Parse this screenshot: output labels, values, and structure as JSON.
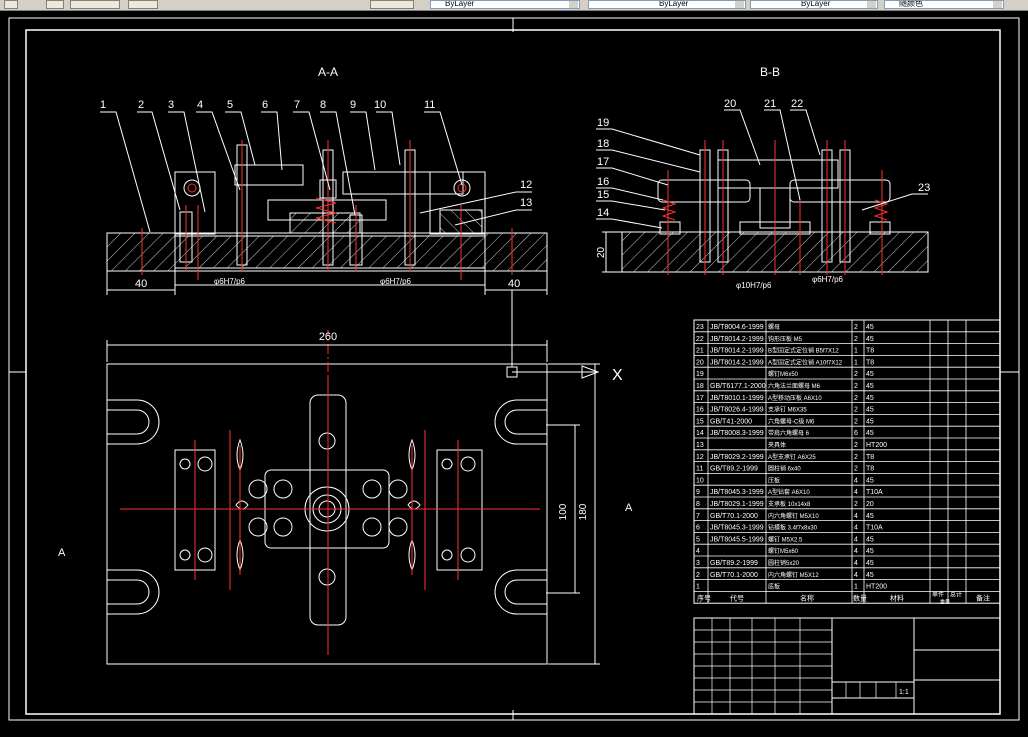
{
  "toolbar": {
    "layer_combo": "ByLayer",
    "linetype_combo": "ByLayer",
    "lineweight_combo": "ByLayer",
    "plotstyle_combo": "随颜色"
  },
  "drawing": {
    "section_aa": "A-A",
    "section_bb": "B-B",
    "view_marker_left": "A",
    "view_marker_right": "A",
    "ucs_x_label": "X",
    "dim_40_left": "40",
    "dim_40_right": "40",
    "dim_fit_a": "φ6H7/p6",
    "dim_fit_b": "φ6H7/p6",
    "dim_fit_c": "φ10H7/p6",
    "dim_fit_d": "φ6H7/p6",
    "dim_20": "20",
    "dim_260": "260",
    "dim_100": "100",
    "dim_180": "180",
    "balloons_aa": [
      "1",
      "2",
      "3",
      "4",
      "5",
      "6",
      "7",
      "8",
      "9",
      "10",
      "11",
      "12",
      "13"
    ],
    "balloons_bb": [
      "19",
      "18",
      "17",
      "16",
      "15",
      "14",
      "20",
      "21",
      "22",
      "23"
    ]
  },
  "bom": {
    "rows": [
      {
        "no": "23",
        "code": "JB/T8004.6-1999",
        "name": "螺母",
        "qty": "2",
        "mat": "45"
      },
      {
        "no": "22",
        "code": "JB/T8014.2-1999",
        "name": "钩形压板 M5",
        "qty": "2",
        "mat": "45"
      },
      {
        "no": "21",
        "code": "JB/T8014.2-1999",
        "name": "B型固定式定位销 B5f7X12",
        "qty": "1",
        "mat": "T8"
      },
      {
        "no": "20",
        "code": "JB/T8014.2-1999",
        "name": "A型固定式定位销 A10f7X12",
        "qty": "1",
        "mat": "T8"
      },
      {
        "no": "19",
        "code": "",
        "name": "螺钉M6x50",
        "qty": "2",
        "mat": "45"
      },
      {
        "no": "18",
        "code": "GB/T6177.1-2000",
        "name": "六角法兰面螺母 M6",
        "qty": "2",
        "mat": "45"
      },
      {
        "no": "17",
        "code": "JB/T8010.1-1999",
        "name": "A型移动压板 A6X10",
        "qty": "2",
        "mat": "45"
      },
      {
        "no": "16",
        "code": "JB/T8026.4-1999",
        "name": "支承钉 M6X35",
        "qty": "2",
        "mat": "45"
      },
      {
        "no": "15",
        "code": "GB/T41-2000",
        "name": "六角螺母-C级 M6",
        "qty": "2",
        "mat": "45"
      },
      {
        "no": "14",
        "code": "JB/T8008.3-1999",
        "name": "带肩六角螺母 6",
        "qty": "6",
        "mat": "45"
      },
      {
        "no": "13",
        "code": "",
        "name": "夹具体",
        "qty": "2",
        "mat": "HT200"
      },
      {
        "no": "12",
        "code": "JB/T8029.2-1999",
        "name": "A型支承钉 A6X25",
        "qty": "2",
        "mat": "T8"
      },
      {
        "no": "11",
        "code": "GB/T89.2-1999",
        "name": "圆柱销 6x40",
        "qty": "2",
        "mat": "T8"
      },
      {
        "no": "10",
        "code": "",
        "name": "压板",
        "qty": "4",
        "mat": "45"
      },
      {
        "no": "9",
        "code": "JB/T8045.3-1999",
        "name": "A型钻套 A6X10",
        "qty": "4",
        "mat": "T10A"
      },
      {
        "no": "8",
        "code": "JB/T8029.1-1999",
        "name": "支承板 10x14x8",
        "qty": "2",
        "mat": "20"
      },
      {
        "no": "7",
        "code": "GB/T70.1-2000",
        "name": "内六角螺钉 M5X10",
        "qty": "4",
        "mat": "45"
      },
      {
        "no": "6",
        "code": "JB/T8045.3-1999",
        "name": "钻模板 3.4f7x8x30",
        "qty": "4",
        "mat": "T10A"
      },
      {
        "no": "5",
        "code": "JB/T8045.5-1999",
        "name": "螺钉 M5X2.5",
        "qty": "4",
        "mat": "45"
      },
      {
        "no": "4",
        "code": "",
        "name": "螺钉M5x60",
        "qty": "4",
        "mat": "45"
      },
      {
        "no": "3",
        "code": "GB/T89.2-1999",
        "name": "圆柱销5x20",
        "qty": "4",
        "mat": "45"
      },
      {
        "no": "2",
        "code": "GB/T70.1-2000",
        "name": "内六角螺钉 M5X12",
        "qty": "4",
        "mat": "45"
      },
      {
        "no": "1",
        "code": "",
        "name": "底板",
        "qty": "1",
        "mat": "HT200"
      }
    ],
    "header": {
      "no": "序号",
      "code": "代号",
      "name": "名称",
      "qty": "数量",
      "mat": "材料",
      "w1": "单件",
      "w2": "总计",
      "weight": "重量",
      "note": "备注"
    }
  },
  "titleblock": {
    "scale": "1:1"
  }
}
